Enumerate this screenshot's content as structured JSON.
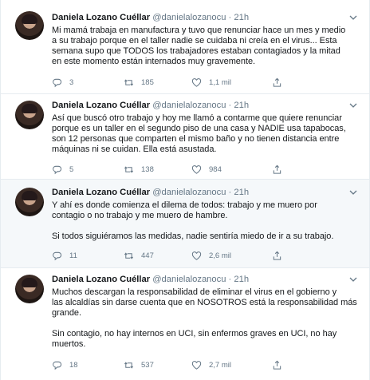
{
  "tweets": [
    {
      "name": "Daniela Lozano Cuéllar",
      "handle": "@danielalozanocu",
      "dot": "·",
      "time": "21h",
      "lines": [
        "Mi mamá trabaja en manufactura y tuvo que renunciar hace un mes y medio",
        "a su trabajo porque en el taller nadie se cuidaba ni creía en el virus... Esta",
        "semana supo que TODOS los trabajadores estaban contagiados y la mitad",
        "en este momento están internados muy gravemente."
      ],
      "replies": "3",
      "retweets": "185",
      "likes": "1,1 mil"
    },
    {
      "name": "Daniela Lozano Cuéllar",
      "handle": "@danielalozanocu",
      "dot": "·",
      "time": "21h",
      "lines": [
        "Así que buscó otro trabajo y hoy me llamó a contarme que quiere renunciar",
        "porque es un taller en el segundo piso de una casa y NADIE usa tapabocas,",
        "son 12 personas que comparten el mismo baño y no tienen distancia entre",
        "máquinas ni se cuidan. Ella está asustada."
      ],
      "replies": "5",
      "retweets": "138",
      "likes": "984"
    },
    {
      "name": "Daniela Lozano Cuéllar",
      "handle": "@danielalozanocu",
      "dot": "·",
      "time": "21h",
      "lines": [
        "Y ahí es donde comienza el dilema de todos: trabajo y me muero por",
        "contagio o no trabajo y me muero de hambre.",
        "",
        "Si todos siguiéramos las medidas, nadie sentiría miedo de ir a su trabajo."
      ],
      "replies": "11",
      "retweets": "447",
      "likes": "2,6 mil"
    },
    {
      "name": "Daniela Lozano Cuéllar",
      "handle": "@danielalozanocu",
      "dot": "·",
      "time": "21h",
      "lines": [
        "Muchos descargan la responsabilidad de eliminar el virus en el gobierno y",
        "las alcaldías sin darse cuenta que en NOSOTROS está la responsabilidad más",
        "grande.",
        "",
        "Sin contagio, no hay internos en UCI, sin enfermos graves en UCI, no hay",
        "muertos."
      ],
      "replies": "18",
      "retweets": "537",
      "likes": "2,7 mil"
    }
  ],
  "icons": {
    "reply": "reply-icon",
    "retweet": "retweet-icon",
    "like": "heart-icon",
    "share": "share-icon",
    "menu": "chevron-down-icon"
  },
  "colors": {
    "text": "#14171a",
    "muted": "#657786",
    "border": "#e6ecf0",
    "highlight_bg": "#f5f8fa"
  }
}
